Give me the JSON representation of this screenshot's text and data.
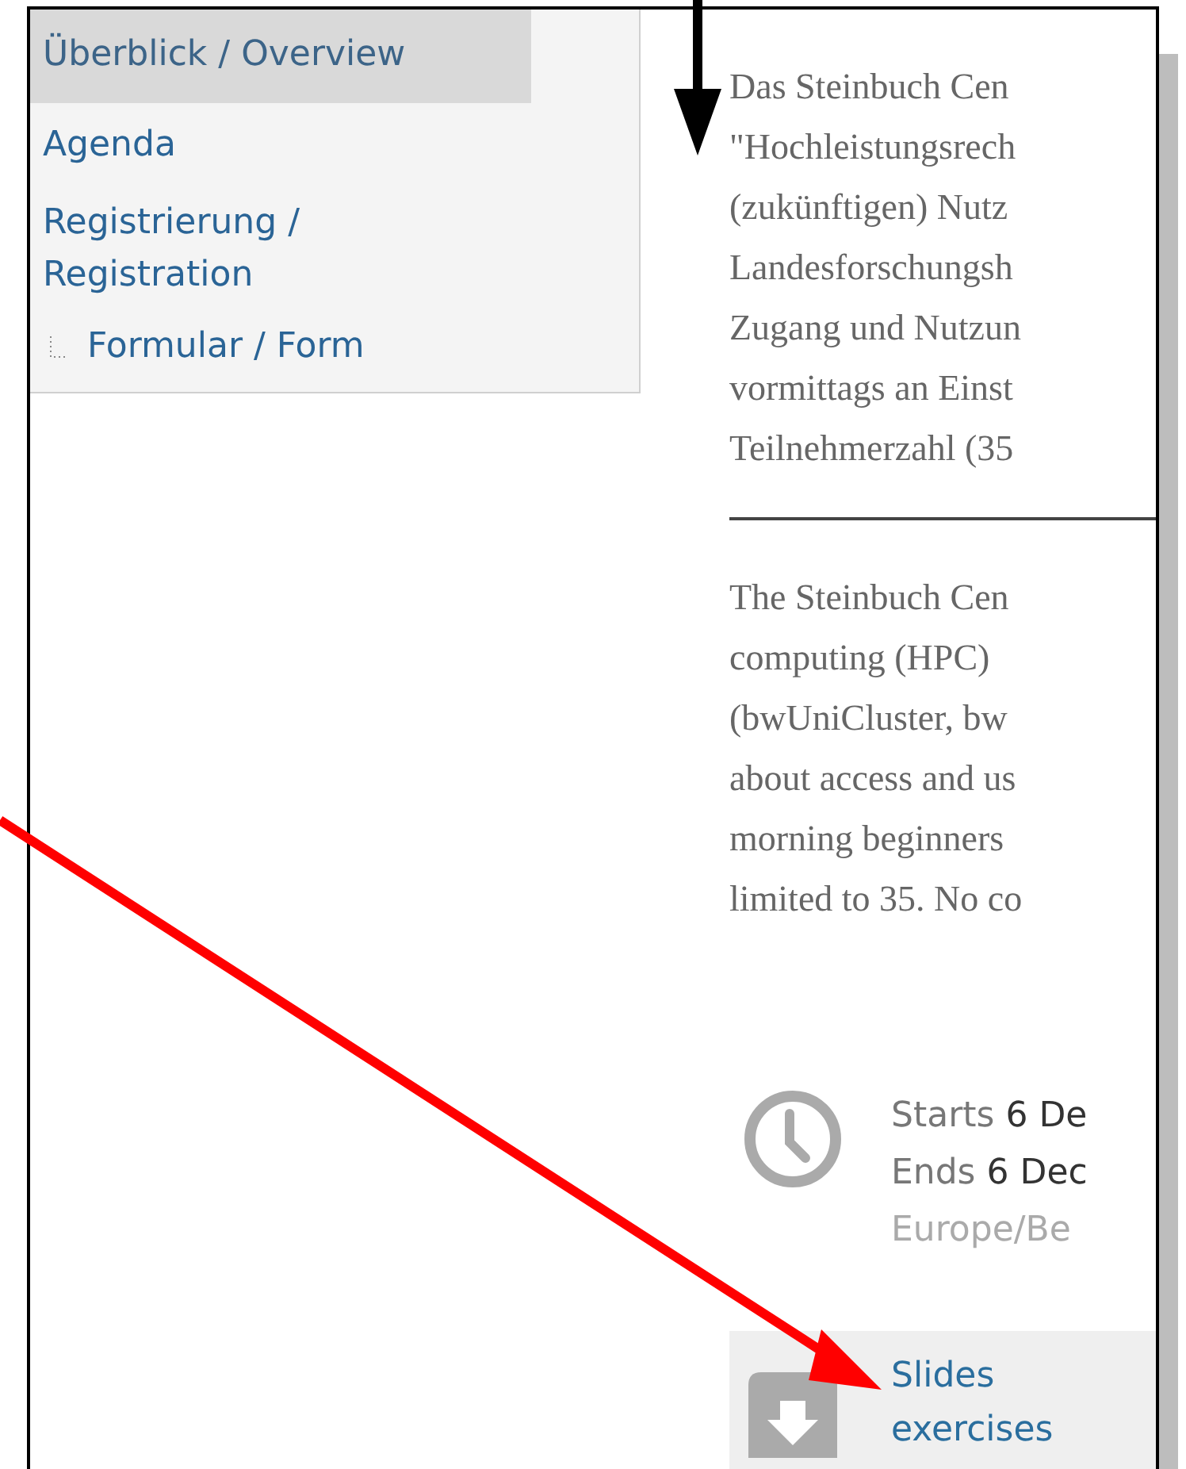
{
  "sidebar": {
    "items": [
      {
        "label": "Überblick / Overview",
        "selected": true
      },
      {
        "label": "Agenda",
        "selected": false
      },
      {
        "label": "Registrierung / Registration",
        "selected": false,
        "children": [
          {
            "label": "Formular / Form",
            "selected": false
          }
        ]
      }
    ]
  },
  "description_de": [
    "Das Steinbuch Cen",
    "\"Hochleistungsrech",
    "(zukünftigen) Nutz",
    "Landesforschungsh",
    "Zugang und Nutzun",
    "vormittags an Einst",
    "Teilnehmerzahl (35"
  ],
  "description_en": [
    "The Steinbuch Cen",
    "computing (HPC)",
    "(bwUniCluster, bw",
    "about access and us",
    "morning beginners",
    "limited to 35. No co"
  ],
  "event_time": {
    "starts_label": "Starts",
    "starts_value": "6 De",
    "ends_label": "Ends",
    "ends_value": "6 Dec",
    "timezone": "Europe/Be"
  },
  "attachments": {
    "links": [
      "Slides",
      "exercises"
    ]
  }
}
